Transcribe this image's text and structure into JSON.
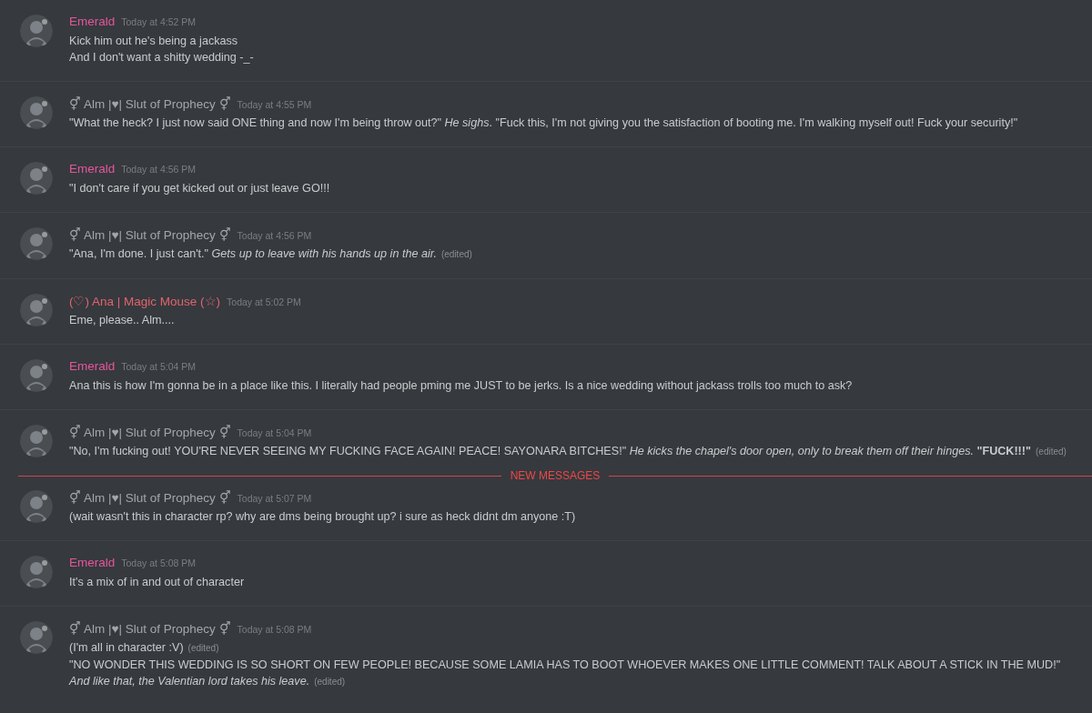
{
  "messages": [
    {
      "kind": "message",
      "author": "Emerald",
      "color": "#e5569b",
      "timestamp": "Today at 4:52 PM",
      "lines": [
        {
          "text": "Kick him out he's being a jackass"
        },
        {
          "text": "And I don't want a shitty wedding -_-"
        }
      ]
    },
    {
      "kind": "message",
      "author": "⚥ Alm |♥| Slut of Prophecy ⚥",
      "color": "#a3a6aa",
      "timestamp": "Today at 4:55 PM",
      "lines": [
        {
          "text": "\"What the heck? I just now said ONE thing and now I'm being throw out?\" *He sighs*. \"Fuck this, I'm not giving you the satisfaction of booting me. I'm walking myself out! Fuck your security!\""
        }
      ]
    },
    {
      "kind": "message",
      "author": "Emerald",
      "color": "#e5569b",
      "timestamp": "Today at 4:56 PM",
      "lines": [
        {
          "text": "\"I don't care if you get kicked out or just leave GO!!!"
        }
      ]
    },
    {
      "kind": "message",
      "author": "⚥ Alm |♥| Slut of Prophecy ⚥",
      "color": "#a3a6aa",
      "timestamp": "Today at 4:56 PM",
      "lines": [
        {
          "text": "\"Ana, I'm done. I just can't.\" *Gets up to leave with his hands up in the air.*",
          "edited": "(edited)"
        }
      ]
    },
    {
      "kind": "message",
      "author": "(♡) Ana | Magic Mouse (☆)",
      "color": "#e0646c",
      "timestamp": "Today at 5:02 PM",
      "lines": [
        {
          "text": "Eme, please.. Alm...."
        }
      ]
    },
    {
      "kind": "message",
      "author": "Emerald",
      "color": "#e5569b",
      "timestamp": "Today at 5:04 PM",
      "lines": [
        {
          "text": "Ana this is how I'm gonna be in a place like this.  I literally had people pming me JUST to be jerks.  Is a nice wedding without jackass trolls too much to ask?"
        }
      ]
    },
    {
      "kind": "message",
      "author": "⚥ Alm |♥| Slut of Prophecy ⚥",
      "color": "#a3a6aa",
      "timestamp": "Today at 5:04 PM",
      "lines": [
        {
          "text": "\"No, I'm fucking out! YOU'RE NEVER SEEING MY FUCKING FACE AGAIN! PEACE! SAYONARA BITCHES!\" *He kicks the chapel's door open, only to break them off their hinges.* **\"FUCK!!!\"**",
          "edited": "(edited)"
        }
      ]
    },
    {
      "kind": "divider",
      "label": "NEW MESSAGES"
    },
    {
      "kind": "message",
      "author": "⚥ Alm |♥| Slut of Prophecy ⚥",
      "color": "#a3a6aa",
      "timestamp": "Today at 5:07 PM",
      "lines": [
        {
          "text": "(wait wasn't this in character rp? why are dms being brought up? i sure as heck didnt dm anyone :T)"
        }
      ]
    },
    {
      "kind": "message",
      "author": "Emerald",
      "color": "#e5569b",
      "timestamp": "Today at 5:08 PM",
      "lines": [
        {
          "text": "It's a mix of in and out of character"
        }
      ]
    },
    {
      "kind": "message",
      "author": "⚥ Alm |♥| Slut of Prophecy ⚥",
      "color": "#a3a6aa",
      "timestamp": "Today at 5:08 PM",
      "lines": [
        {
          "text": "(I'm all in character :V)",
          "edited": "(edited)"
        },
        {
          "text": "\"NO WONDER THIS WEDDING IS SO SHORT ON FEW PEOPLE! BECAUSE SOME LAMIA HAS TO BOOT WHOEVER MAKES ONE LITTLE COMMENT! TALK ABOUT A STICK IN THE MUD!\""
        },
        {
          "text": "*And like that, the Valentian lord takes his leave.*",
          "edited": "(edited)"
        }
      ]
    }
  ]
}
